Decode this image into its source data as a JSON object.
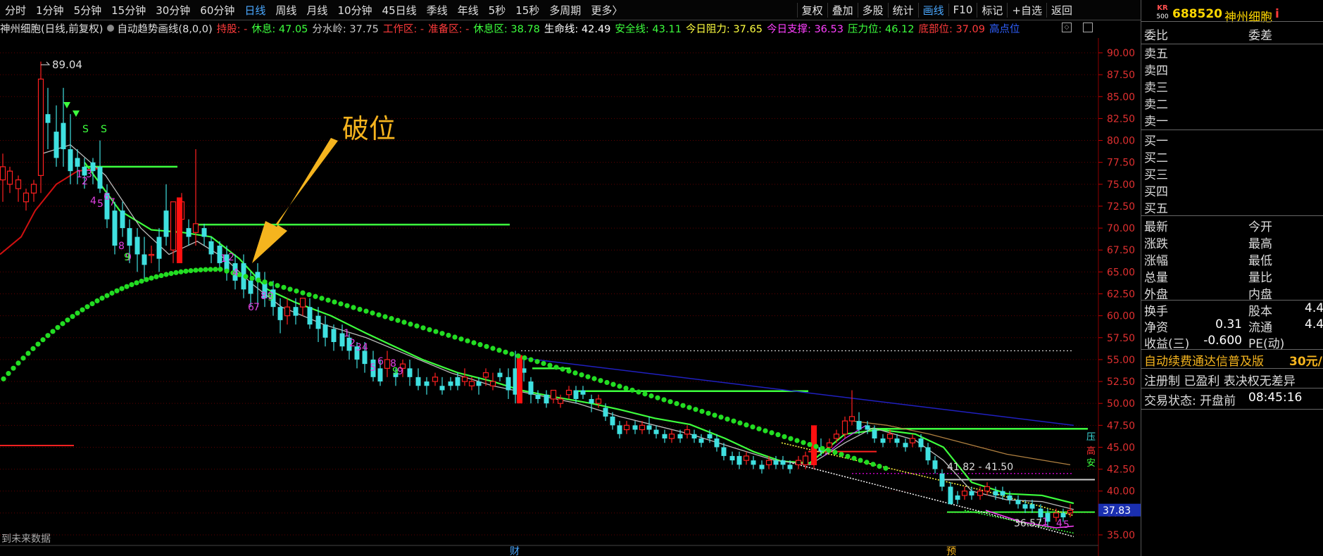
{
  "toolbar": {
    "periods": [
      "分时",
      "1分钟",
      "5分钟",
      "15分钟",
      "30分钟",
      "60分钟",
      "日线",
      "周线",
      "月线",
      "10分钟",
      "45日线",
      "季线",
      "年线",
      "5秒",
      "15秒",
      "多周期",
      "更多〉"
    ],
    "active_period": "日线",
    "right_items": [
      "复权",
      "叠加",
      "多股",
      "统计",
      "画线",
      "F10",
      "标记",
      "+自选",
      "返回"
    ],
    "right_highlight": "画线"
  },
  "infoline": {
    "stock_title": "神州细胞(日线,前复权)",
    "indicator": "自动趋势画线(8,0,0)",
    "items": [
      {
        "text": "持股: -",
        "color": "#ff3b3b"
      },
      {
        "text": "休息: 47.05",
        "color": "#3dff3d"
      },
      {
        "text": "分水岭: 37.75",
        "color": "#c8c8c8"
      },
      {
        "text": "工作区: -",
        "color": "#ff3b3b"
      },
      {
        "text": "准备区: -",
        "color": "#ff3b3b"
      },
      {
        "text": "休息区: 38.78",
        "color": "#3dff3d"
      },
      {
        "text": "生命线: 42.49",
        "color": "#ffffff"
      },
      {
        "text": "安全线: 43.11",
        "color": "#3dff3d"
      },
      {
        "text": "今日阻力: 37.65",
        "color": "#ffff40"
      },
      {
        "text": "今日支撑: 36.53",
        "color": "#ff40ff"
      },
      {
        "text": "压力位: 46.12",
        "color": "#3dff3d"
      },
      {
        "text": "底部位: 37.09",
        "color": "#ff3b3b"
      },
      {
        "text": "高点位",
        "color": "#3060ff"
      }
    ]
  },
  "annotation": {
    "label": "破位",
    "color": "#f5b41e"
  },
  "price_axis": {
    "ticks": [
      "90.00",
      "87.50",
      "85.00",
      "82.50",
      "80.00",
      "77.50",
      "75.00",
      "72.50",
      "70.00",
      "67.50",
      "65.00",
      "62.50",
      "60.00",
      "57.50",
      "55.00",
      "52.50",
      "50.00",
      "47.50",
      "45.00",
      "42.50",
      "40.00",
      "37.50",
      "35.00"
    ],
    "current_price": "37.83"
  },
  "chart_labels": {
    "high_price": "89.04",
    "range_label": "41.82 - 41.50",
    "low_price": "36.57",
    "future_data": "到未来数据",
    "bottom_marker_1": "财",
    "bottom_marker_2": "预",
    "side_label_1": "压",
    "side_label_2": "高",
    "side_label_3": "安"
  },
  "panel": {
    "logo_top": "KR",
    "logo_bottom": "500",
    "code": "688520",
    "name": "神州细胞",
    "badge": "i",
    "header_left": "委比",
    "header_right": "委差",
    "sells": [
      "卖五",
      "卖四",
      "卖三",
      "卖二",
      "卖一"
    ],
    "buys": [
      "买一",
      "买二",
      "买三",
      "买四",
      "买五"
    ],
    "stats_left": [
      "最新",
      "涨跌",
      "涨幅",
      "总量",
      "外盘"
    ],
    "stats_right": [
      "今开",
      "最高",
      "最低",
      "量比",
      "内盘"
    ],
    "fin_rows": [
      {
        "l": "换手",
        "lv": "",
        "r": "股本",
        "rv": "4.4"
      },
      {
        "l": "净资",
        "lv": "0.31",
        "r": "流通",
        "rv": "4.4"
      },
      {
        "l": "收益(三)",
        "lv": "-0.600",
        "r": "PE(动)",
        "rv": ""
      }
    ],
    "promo": "自动续费通达信普及版",
    "promo_price": "30元/",
    "reg": "注册制 已盈利 表决权无差异",
    "status": "交易状态: 开盘前",
    "status_time": "08:45:16"
  }
}
